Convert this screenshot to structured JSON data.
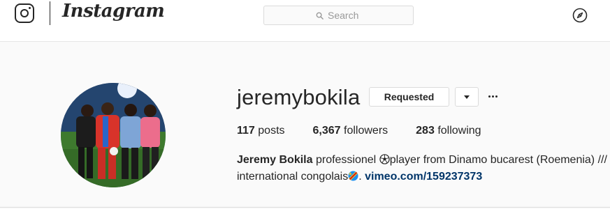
{
  "header": {
    "brand": "Instagram",
    "search_placeholder": "Search"
  },
  "profile": {
    "username": "jeremybokila",
    "follow_button": "Requested",
    "stats": {
      "posts_count": "117",
      "posts_label": "posts",
      "followers_count": "6,367",
      "followers_label": "followers",
      "following_count": "283",
      "following_label": "following"
    },
    "bio": {
      "full_name": "Jeremy Bokila",
      "text_before_ball": " professionel ",
      "text_after_ball": "player from Dinamo bucarest (Roemenia) ///",
      "text_line2": "international congolais",
      "text_after_flag": ". ",
      "link": "vimeo.com/159237373"
    }
  },
  "icons": {
    "logo": "instagram-glyph-icon",
    "search": "search-icon",
    "explore": "compass-icon",
    "dropdown": "chevron-down-icon",
    "more": "more-options-icon",
    "ball": "soccer-ball-emoji",
    "flag": "drc-flag-emoji"
  },
  "colors": {
    "link": "#003569",
    "border": "#dbdbdb",
    "text": "#262626"
  }
}
